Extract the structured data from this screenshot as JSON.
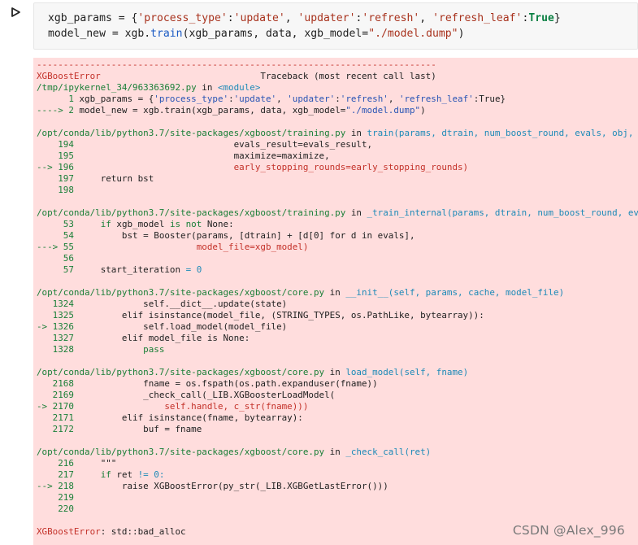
{
  "cell": {
    "run_button_icon": "play-triangle-icon",
    "lines": [
      [
        {
          "t": "xgb_params = {"
        },
        {
          "t": "'process_type'",
          "c": "str"
        },
        {
          "t": ":"
        },
        {
          "t": "'update'",
          "c": "str"
        },
        {
          "t": ", "
        },
        {
          "t": "'updater'",
          "c": "str"
        },
        {
          "t": ":"
        },
        {
          "t": "'refresh'",
          "c": "str"
        },
        {
          "t": ", "
        },
        {
          "t": "'refresh_leaf'",
          "c": "str"
        },
        {
          "t": ":"
        },
        {
          "t": "True",
          "c": "kw"
        },
        {
          "t": "}"
        }
      ],
      [
        {
          "t": "model_new = xgb."
        },
        {
          "t": "train",
          "c": "fn"
        },
        {
          "t": "(xgb_params, data, xgb_model="
        },
        {
          "t": "\"./model.dump\"",
          "c": "str"
        },
        {
          "t": ")"
        }
      ]
    ]
  },
  "traceback": [
    [
      {
        "t": "---------------------------------------------------------------------------",
        "c": "r"
      }
    ],
    [
      {
        "t": "XGBoostError",
        "c": "r"
      },
      {
        "t": "                              Traceback (most recent call last)"
      }
    ],
    [
      {
        "t": "/tmp/ipykernel_34/963363692.py",
        "c": "g"
      },
      {
        "t": " in "
      },
      {
        "t": "<module>",
        "c": "c"
      }
    ],
    [
      {
        "t": "      1 ",
        "c": "g"
      },
      {
        "t": "xgb_params = {"
      },
      {
        "t": "'process_type'",
        "c": "b"
      },
      {
        "t": ":"
      },
      {
        "t": "'update'",
        "c": "b"
      },
      {
        "t": ", "
      },
      {
        "t": "'updater'",
        "c": "b"
      },
      {
        "t": ":"
      },
      {
        "t": "'refresh'",
        "c": "b"
      },
      {
        "t": ", "
      },
      {
        "t": "'refresh_leaf'",
        "c": "b"
      },
      {
        "t": ":"
      },
      {
        "t": "True"
      },
      {
        "t": "}"
      }
    ],
    [
      {
        "t": "----> 2 ",
        "c": "g"
      },
      {
        "t": "model_new = xgb.train(xgb_params, data, xgb_model="
      },
      {
        "t": "\"./model.dump\"",
        "c": "b"
      },
      {
        "t": ")"
      }
    ],
    [
      {
        "t": ""
      }
    ],
    [
      {
        "t": "/opt/conda/lib/python3.7/site-packages/xgboost/training.py",
        "c": "g"
      },
      {
        "t": " in "
      },
      {
        "t": "train",
        "c": "c"
      },
      {
        "t": "(params, dtrain, num_boost_round, evals, obj, feval, maximize, early_stopping_rounds, evals_result, verbose_eval, xgb_model, callbacks)",
        "c": "c"
      }
    ],
    [
      {
        "t": "    194 ",
        "c": "g"
      },
      {
        "t": "                             evals_result=evals_result,"
      }
    ],
    [
      {
        "t": "    195 ",
        "c": "g"
      },
      {
        "t": "                             maximize=maximize,"
      }
    ],
    [
      {
        "t": "--> 196 ",
        "c": "g"
      },
      {
        "t": "                             early_stopping_rounds=early_stopping_rounds)",
        "c": "r"
      }
    ],
    [
      {
        "t": "    197 ",
        "c": "g"
      },
      {
        "t": "    return bst"
      }
    ],
    [
      {
        "t": "    198 ",
        "c": "g"
      }
    ],
    [
      {
        "t": ""
      }
    ],
    [
      {
        "t": "/opt/conda/lib/python3.7/site-packages/xgboost/training.py",
        "c": "g"
      },
      {
        "t": " in "
      },
      {
        "t": "_train_internal",
        "c": "c"
      },
      {
        "t": "(params, dtrain, num_boost_round, evals, obj, feval, xgb_model, callbacks, evals_result, maximize, verbose_eval, early_stopping_rounds)",
        "c": "c"
      }
    ],
    [
      {
        "t": "     53 ",
        "c": "g"
      },
      {
        "t": "    "
      },
      {
        "t": "if",
        "c": "g"
      },
      {
        "t": " xgb_model "
      },
      {
        "t": "is not",
        "c": "g"
      },
      {
        "t": " None:"
      }
    ],
    [
      {
        "t": "     54 ",
        "c": "g"
      },
      {
        "t": "        bst = Booster(params, [dtrain] + [d[0] for d in evals],"
      }
    ],
    [
      {
        "t": "---> 55 ",
        "c": "g"
      },
      {
        "t": "                      model_file=xgb_model)",
        "c": "r"
      }
    ],
    [
      {
        "t": "     56 ",
        "c": "g"
      }
    ],
    [
      {
        "t": "     57 ",
        "c": "g"
      },
      {
        "t": "    start_iteration "
      },
      {
        "t": "= 0",
        "c": "c"
      }
    ],
    [
      {
        "t": ""
      }
    ],
    [
      {
        "t": "/opt/conda/lib/python3.7/site-packages/xgboost/core.py",
        "c": "g"
      },
      {
        "t": " in "
      },
      {
        "t": "__init__",
        "c": "c"
      },
      {
        "t": "(self, params, cache, model_file)",
        "c": "c"
      }
    ],
    [
      {
        "t": "   1324 ",
        "c": "g"
      },
      {
        "t": "            self.__dict__.update(state)"
      }
    ],
    [
      {
        "t": "   1325 ",
        "c": "g"
      },
      {
        "t": "        elif isinstance(model_file, (STRING_TYPES, os.PathLike, bytearray)):"
      }
    ],
    [
      {
        "t": "-> 1326 ",
        "c": "g"
      },
      {
        "t": "            self.load_model(model_file)"
      }
    ],
    [
      {
        "t": "   1327 ",
        "c": "g"
      },
      {
        "t": "        elif model_file is None:"
      }
    ],
    [
      {
        "t": "   1328 ",
        "c": "g"
      },
      {
        "t": "            pass",
        "c": "g"
      }
    ],
    [
      {
        "t": ""
      }
    ],
    [
      {
        "t": "/opt/conda/lib/python3.7/site-packages/xgboost/core.py",
        "c": "g"
      },
      {
        "t": " in "
      },
      {
        "t": "load_model",
        "c": "c"
      },
      {
        "t": "(self, fname)",
        "c": "c"
      }
    ],
    [
      {
        "t": "   2168 ",
        "c": "g"
      },
      {
        "t": "            fname = os.fspath(os.path.expanduser(fname))"
      }
    ],
    [
      {
        "t": "   2169 ",
        "c": "g"
      },
      {
        "t": "            _check_call(_LIB.XGBoosterLoadModel("
      }
    ],
    [
      {
        "t": "-> 2170 ",
        "c": "g"
      },
      {
        "t": "                self.handle, c_str(fname)))",
        "c": "r"
      }
    ],
    [
      {
        "t": "   2171 ",
        "c": "g"
      },
      {
        "t": "        elif isinstance(fname, bytearray):"
      }
    ],
    [
      {
        "t": "   2172 ",
        "c": "g"
      },
      {
        "t": "            buf = fname"
      }
    ],
    [
      {
        "t": ""
      }
    ],
    [
      {
        "t": "/opt/conda/lib/python3.7/site-packages/xgboost/core.py",
        "c": "g"
      },
      {
        "t": " in "
      },
      {
        "t": "_check_call",
        "c": "c"
      },
      {
        "t": "(ret)",
        "c": "c"
      }
    ],
    [
      {
        "t": "    216 ",
        "c": "g"
      },
      {
        "t": "    \"\"\""
      }
    ],
    [
      {
        "t": "    217 ",
        "c": "g"
      },
      {
        "t": "    "
      },
      {
        "t": "if",
        "c": "g"
      },
      {
        "t": " ret "
      },
      {
        "t": "!= 0:",
        "c": "c"
      }
    ],
    [
      {
        "t": "--> 218 ",
        "c": "g"
      },
      {
        "t": "        raise XGBoostError(py_str(_LIB.XGBGetLastError()))"
      }
    ],
    [
      {
        "t": "    219 ",
        "c": "g"
      }
    ],
    [
      {
        "t": "    220 ",
        "c": "g"
      }
    ],
    [
      {
        "t": ""
      }
    ],
    [
      {
        "t": "XGBoostError",
        "c": "r"
      },
      {
        "t": ": std::bad_alloc"
      }
    ]
  ],
  "watermark": "CSDN @Alex_996"
}
